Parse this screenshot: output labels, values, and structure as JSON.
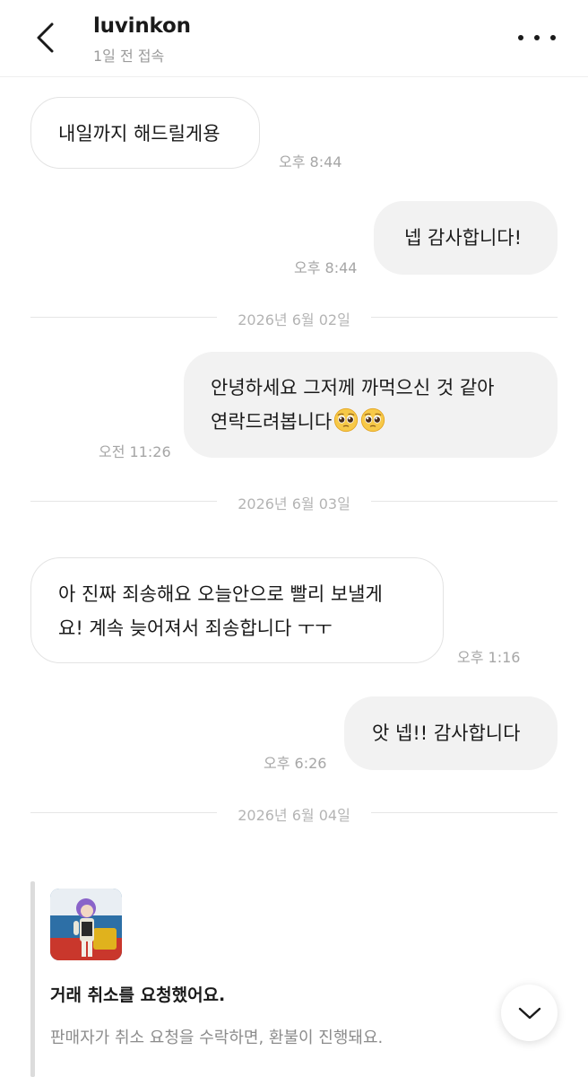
{
  "header": {
    "username": "luvinkon",
    "last_seen": "1일 전 접속",
    "back_icon": "chevron-left-icon",
    "menu_icon": "more-horizontal-icon"
  },
  "messages": [
    {
      "side": "them",
      "text": "내일까지 해드릴게용",
      "time": "오후 8:44"
    },
    {
      "side": "me",
      "text": "넵 감사합니다!",
      "time": "오후 8:44"
    },
    {
      "side": "me",
      "line1": "안녕하세요 그저께 까먹으신 것 같아",
      "line2": "연락드려봅니다",
      "emoji": "pleading-face-emoji",
      "time": "오전 11:26"
    },
    {
      "side": "them",
      "line1": "아 진짜 죄송해요 오늘안으로 빨리 보낼게",
      "line2": "요! 계속 늦어져서 죄송합니다 ㅜㅜ",
      "time": "오후 1:16"
    },
    {
      "side": "me",
      "text": "앗 넵!! 감사합니다",
      "time": "오후 6:26"
    }
  ],
  "date_separators": [
    "2026년 6월 02일",
    "2026년 6월 03일",
    "2026년 6월 04일"
  ],
  "system_card": {
    "title": "거래 취소를 요청했어요.",
    "description": "판매자가 취소 요청을 수락하면, 환불이 진행돼요."
  },
  "scroll_down_icon": "chevron-down-icon",
  "colors": {
    "my_bubble": "#f2f2f2",
    "their_bubble_border": "#e3e3e3",
    "muted_text": "#a6a6a6"
  }
}
